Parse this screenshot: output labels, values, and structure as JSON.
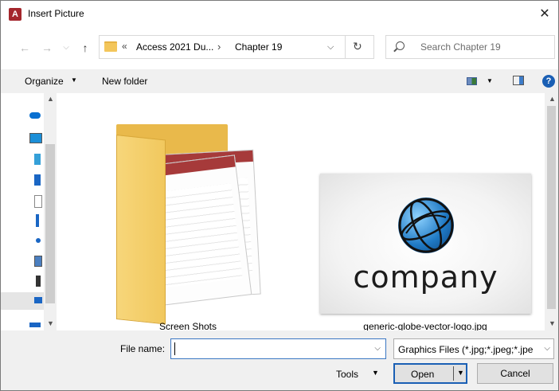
{
  "window": {
    "title": "Insert Picture",
    "app_icon": "A",
    "close": "✕"
  },
  "nav": {
    "back": "←",
    "forward": "→",
    "recent": "⌵",
    "up": "↑"
  },
  "address": {
    "more": "«",
    "crumbs": [
      "Access 2021 Du...",
      "Chapter 19"
    ],
    "sep": "›",
    "dropdown": "⌵",
    "refresh": "↻"
  },
  "search": {
    "placeholder": "Search Chapter 19"
  },
  "toolbar": {
    "organize": "Organize",
    "caret": "▼",
    "new_folder": "New folder",
    "help": "?"
  },
  "items": [
    {
      "name": "Screen Shots",
      "type": "folder"
    },
    {
      "name": "generic-globe-vector-logo.jpg",
      "type": "image",
      "image_text": "company"
    }
  ],
  "bottom": {
    "file_name_label": "File name:",
    "file_name_value": "",
    "file_type": "Graphics Files (*.jpg;*.jpeg;*.jpe",
    "tools": "Tools",
    "open": "Open",
    "cancel": "Cancel",
    "caret": "▼"
  },
  "colors": {
    "accent": "#1a5fb4",
    "app_red": "#a4262c",
    "folder": "#f1c85e"
  }
}
